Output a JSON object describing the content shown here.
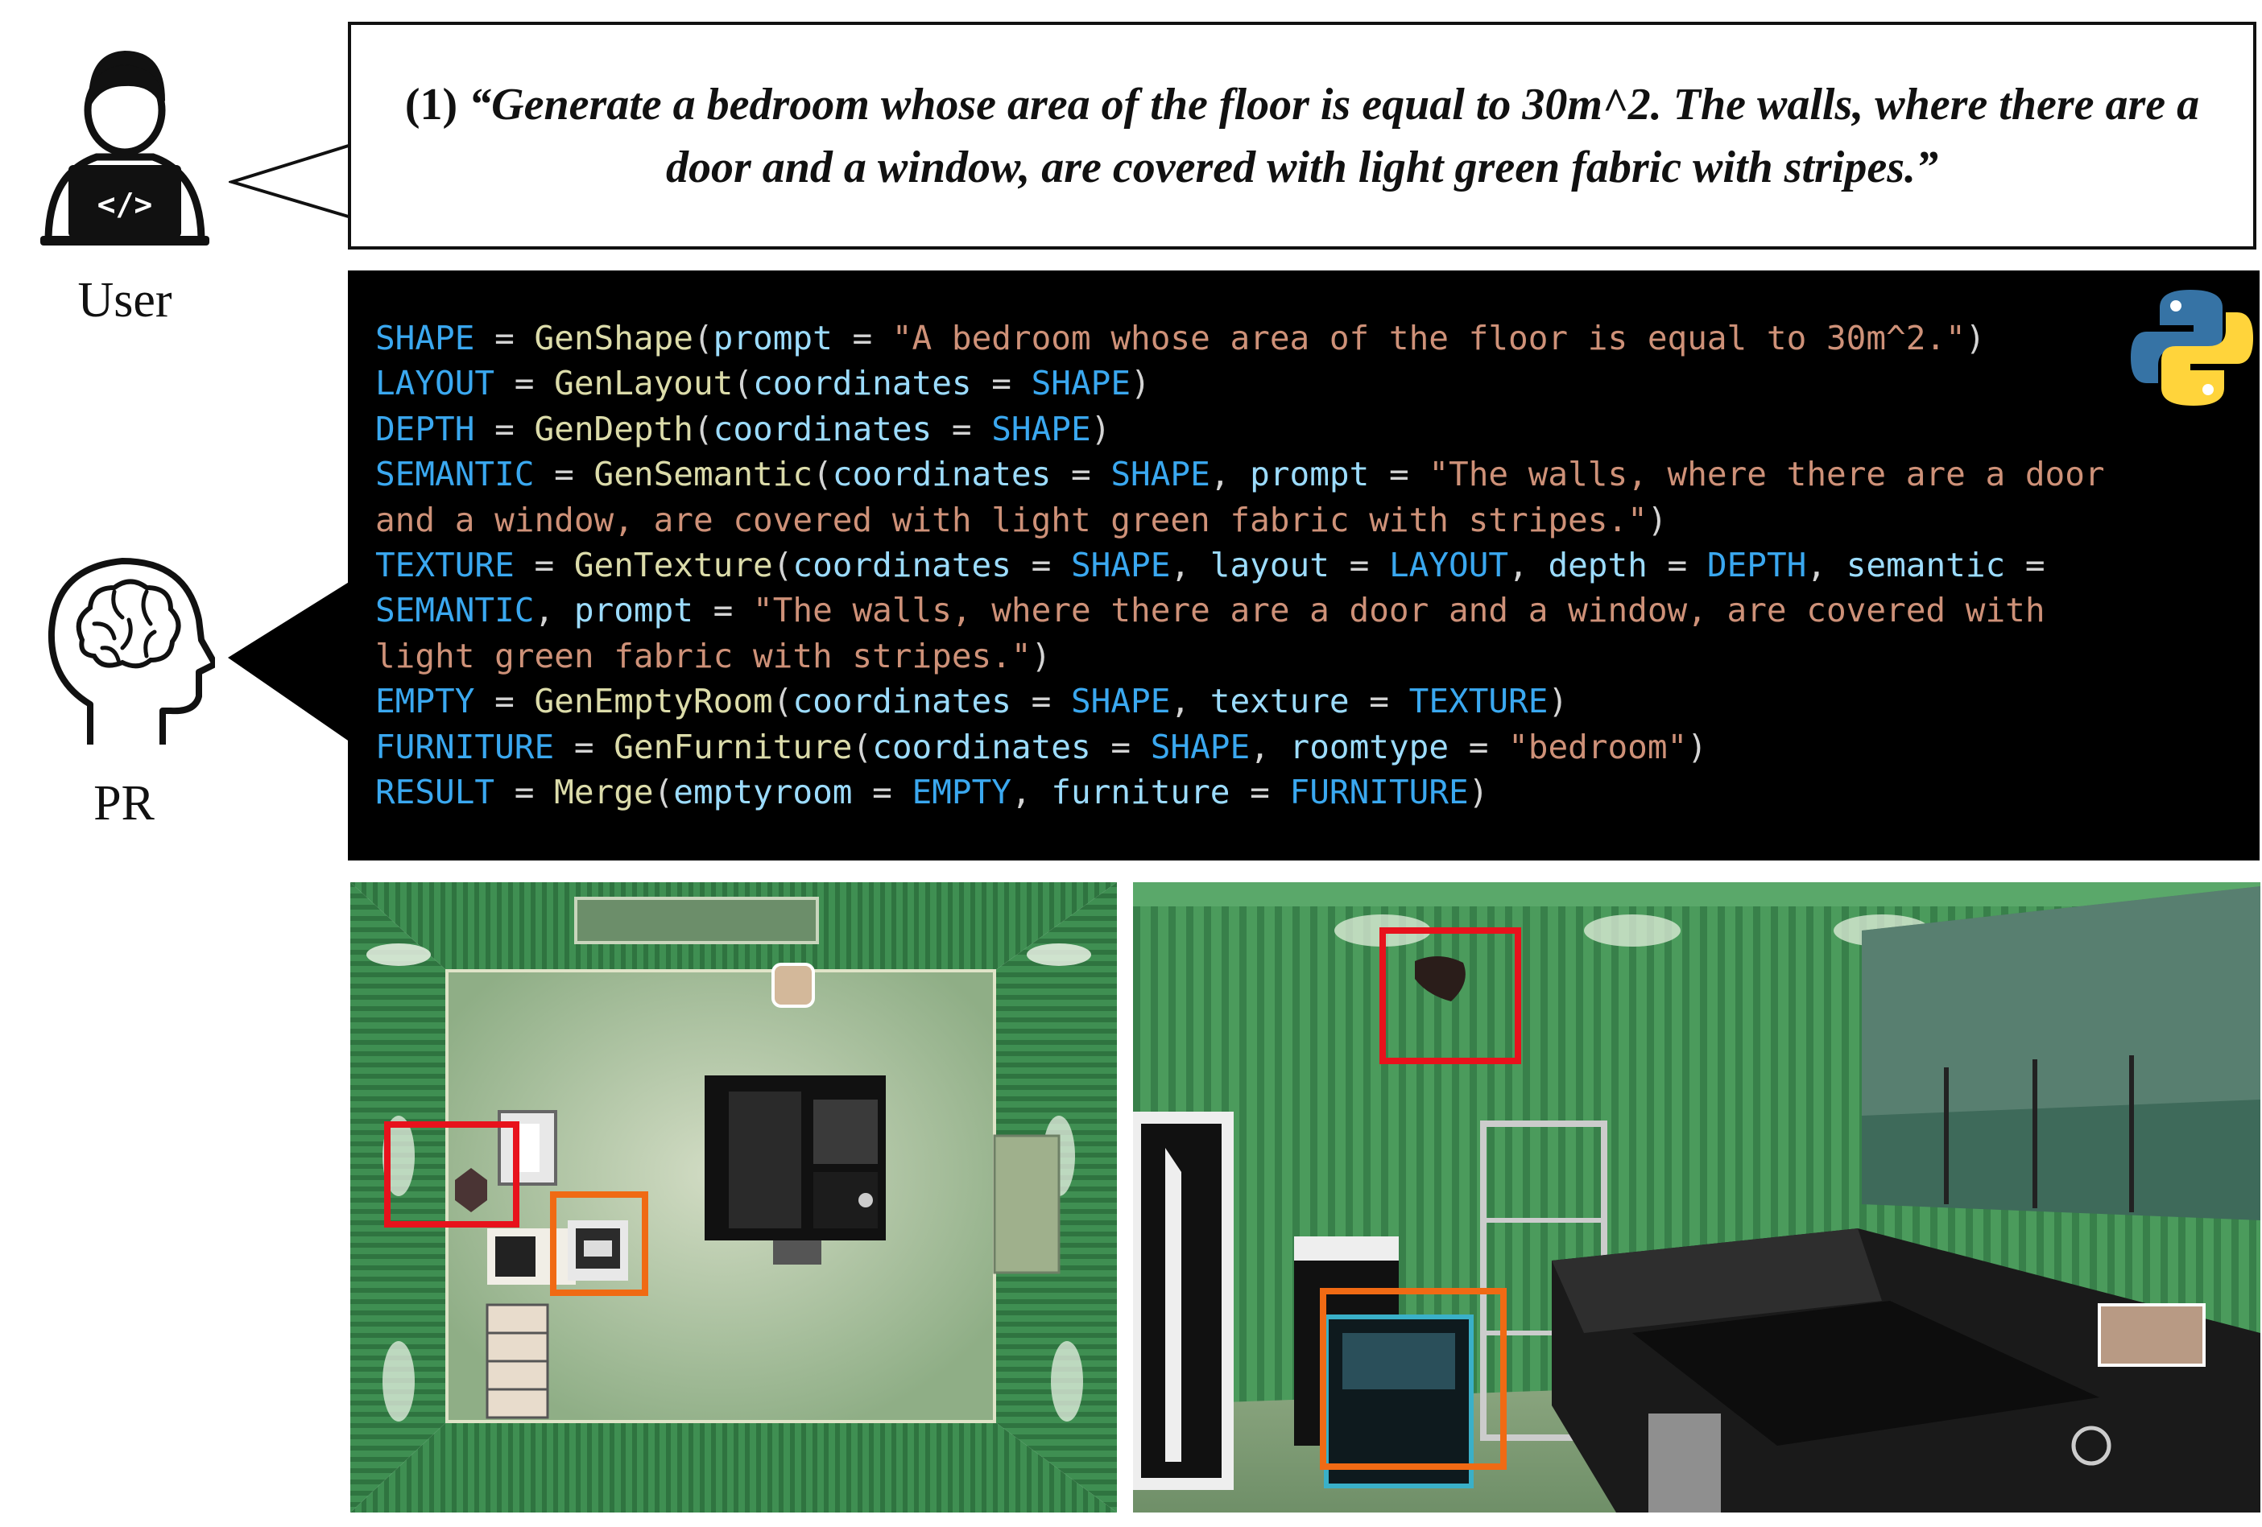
{
  "user": {
    "label": "User"
  },
  "pr": {
    "label": "PR"
  },
  "prompt": {
    "number": "(1)",
    "text": "“Generate a bedroom whose area of the floor is equal to 30m^2. The walls, where there are a door and a window, are covered with light green fabric with stripes.”"
  },
  "code": {
    "lines": [
      [
        [
          "v",
          "SHAPE"
        ],
        [
          "o",
          " = "
        ],
        [
          "f",
          "GenShape"
        ],
        [
          "o",
          "("
        ],
        [
          "p",
          "prompt"
        ],
        [
          "o",
          " = "
        ],
        [
          "s",
          "\"A bedroom whose area of the floor is equal to 30m^2.\""
        ],
        [
          "o",
          ")"
        ]
      ],
      [
        [
          "v",
          "LAYOUT"
        ],
        [
          "o",
          " = "
        ],
        [
          "f",
          "GenLayout"
        ],
        [
          "o",
          "("
        ],
        [
          "p",
          "coordinates"
        ],
        [
          "o",
          " = "
        ],
        [
          "v",
          "SHAPE"
        ],
        [
          "o",
          ")"
        ]
      ],
      [
        [
          "v",
          "DEPTH"
        ],
        [
          "o",
          " = "
        ],
        [
          "f",
          "GenDepth"
        ],
        [
          "o",
          "("
        ],
        [
          "p",
          "coordinates"
        ],
        [
          "o",
          " = "
        ],
        [
          "v",
          "SHAPE"
        ],
        [
          "o",
          ")"
        ]
      ],
      [
        [
          "v",
          "SEMANTIC"
        ],
        [
          "o",
          " = "
        ],
        [
          "f",
          "GenSemantic"
        ],
        [
          "o",
          "("
        ],
        [
          "p",
          "coordinates"
        ],
        [
          "o",
          " = "
        ],
        [
          "v",
          "SHAPE"
        ],
        [
          "o",
          ", "
        ],
        [
          "p",
          "prompt"
        ],
        [
          "o",
          " = "
        ],
        [
          "s",
          "\"The walls, where there are a door"
        ]
      ],
      [
        [
          "s",
          "and a window, are covered with light green fabric with stripes.\""
        ],
        [
          "o",
          ")"
        ]
      ],
      [
        [
          "v",
          "TEXTURE"
        ],
        [
          "o",
          " = "
        ],
        [
          "f",
          "GenTexture"
        ],
        [
          "o",
          "("
        ],
        [
          "p",
          "coordinates"
        ],
        [
          "o",
          " = "
        ],
        [
          "v",
          "SHAPE"
        ],
        [
          "o",
          ", "
        ],
        [
          "p",
          "layout"
        ],
        [
          "o",
          " = "
        ],
        [
          "v",
          "LAYOUT"
        ],
        [
          "o",
          ", "
        ],
        [
          "p",
          "depth"
        ],
        [
          "o",
          " = "
        ],
        [
          "v",
          "DEPTH"
        ],
        [
          "o",
          ", "
        ],
        [
          "p",
          "semantic"
        ],
        [
          "o",
          " ="
        ]
      ],
      [
        [
          "v",
          "SEMANTIC"
        ],
        [
          "o",
          ", "
        ],
        [
          "p",
          "prompt"
        ],
        [
          "o",
          " = "
        ],
        [
          "s",
          "\"The walls, where there are a door and a window, are covered with"
        ]
      ],
      [
        [
          "s",
          "light green fabric with stripes.\""
        ],
        [
          "o",
          ")"
        ]
      ],
      [
        [
          "v",
          "EMPTY"
        ],
        [
          "o",
          " = "
        ],
        [
          "f",
          "GenEmptyRoom"
        ],
        [
          "o",
          "("
        ],
        [
          "p",
          "coordinates"
        ],
        [
          "o",
          " = "
        ],
        [
          "v",
          "SHAPE"
        ],
        [
          "o",
          ", "
        ],
        [
          "p",
          "texture"
        ],
        [
          "o",
          " = "
        ],
        [
          "v",
          "TEXTURE"
        ],
        [
          "o",
          ")"
        ]
      ],
      [
        [
          "v",
          "FURNITURE"
        ],
        [
          "o",
          " = "
        ],
        [
          "f",
          "GenFurniture"
        ],
        [
          "o",
          "("
        ],
        [
          "p",
          "coordinates"
        ],
        [
          "o",
          " = "
        ],
        [
          "v",
          "SHAPE"
        ],
        [
          "o",
          ", "
        ],
        [
          "p",
          "roomtype"
        ],
        [
          "o",
          " = "
        ],
        [
          "s",
          "\"bedroom\""
        ],
        [
          "o",
          ")"
        ]
      ],
      [
        [
          "v",
          "RESULT"
        ],
        [
          "o",
          " = "
        ],
        [
          "f",
          "Merge"
        ],
        [
          "o",
          "("
        ],
        [
          "p",
          "emptyroom"
        ],
        [
          "o",
          " = "
        ],
        [
          "v",
          "EMPTY"
        ],
        [
          "o",
          ", "
        ],
        [
          "p",
          "furniture"
        ],
        [
          "o",
          " = "
        ],
        [
          "v",
          "FURNITURE"
        ],
        [
          "o",
          ")"
        ]
      ]
    ]
  },
  "colors": {
    "variable": "#3aa8f0",
    "function": "#dcdcaa",
    "param": "#9cdcfe",
    "string": "#ce9178",
    "highlight_red": "#e8121c",
    "highlight_orange": "#f06a14",
    "wall_green": "#3f8a4f"
  },
  "icons": [
    "user-coder-icon",
    "brain-head-icon",
    "python-logo-icon"
  ]
}
